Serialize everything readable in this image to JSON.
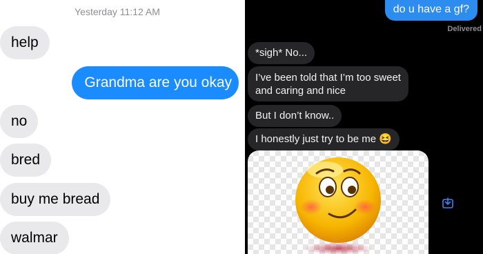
{
  "left_chat": {
    "timestamp_day": "Yesterday",
    "timestamp_time": "11:12 AM",
    "messages": [
      {
        "from": "other",
        "text": "help"
      },
      {
        "from": "me",
        "text": "Grandma are you okay"
      },
      {
        "from": "other",
        "text": "no"
      },
      {
        "from": "other",
        "text": "bred"
      },
      {
        "from": "other",
        "text": "buy me bread"
      },
      {
        "from": "other",
        "text": "walmar"
      }
    ],
    "colors": {
      "incoming_bubble": "#e9e9eb",
      "outgoing_bubble": "#1a8cff"
    }
  },
  "right_chat": {
    "outgoing_message": "do u have a gf?",
    "status": "Delivered",
    "messages": [
      {
        "text": "*sigh* No..."
      },
      {
        "text": "I’ve been told that I’m too sweet and caring and nice",
        "lines": [
          "I’ve been told that I’m too sweet",
          "and caring and nice"
        ]
      },
      {
        "text": "But I don’t know.."
      },
      {
        "text": "I honestly just try to be me",
        "emoji": "😆"
      }
    ],
    "sticker": {
      "icon": "blushing-smirk-emoji-icon"
    },
    "save_icon": "download-icon",
    "colors": {
      "background": "#000000",
      "incoming_bubble": "#262628",
      "outgoing_bubble": "#2d8cf0"
    }
  }
}
